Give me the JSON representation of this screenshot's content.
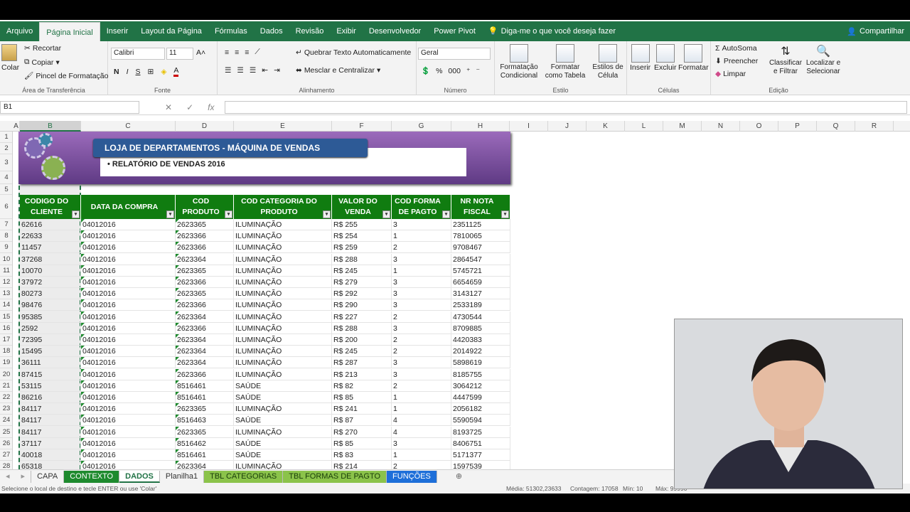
{
  "menu": {
    "items": [
      "Arquivo",
      "Página Inicial",
      "Inserir",
      "Layout da Página",
      "Fórmulas",
      "Dados",
      "Revisão",
      "Exibir",
      "Desenvolvedor",
      "Power Pivot"
    ],
    "tell_me": "Diga-me o que você deseja fazer",
    "share": "Compartilhar"
  },
  "ribbon": {
    "paste": "Colar",
    "cut": "Recortar",
    "copy": "Copiar",
    "format_painter": "Pincel de Formatação",
    "clipboard_label": "Área de Transferência",
    "font_name": "Calibri",
    "font_size": "11",
    "font_label": "Fonte",
    "wrap_text": "Quebrar Texto Automaticamente",
    "merge_center": "Mesclar e Centralizar",
    "alignment_label": "Alinhamento",
    "number_format": "Geral",
    "number_label": "Número",
    "conditional_format": "Formatação Condicional",
    "format_as_table": "Formatar como Tabela",
    "cell_styles": "Estilos de Célula",
    "style_label": "Estilo",
    "insert": "Inserir",
    "delete": "Excluir",
    "format": "Formatar",
    "cells_label": "Células",
    "autosum": "AutoSoma",
    "fill": "Preencher",
    "clear": "Limpar",
    "sort_filter": "Classificar e Filtrar",
    "find_select": "Localizar e Selecionar",
    "editing_label": "Edição"
  },
  "formula_bar": {
    "name_box": "B1",
    "formula": ""
  },
  "columns": [
    "A",
    "B",
    "C",
    "D",
    "E",
    "F",
    "G",
    "H",
    "I",
    "J",
    "K",
    "L",
    "M",
    "N",
    "O",
    "P",
    "Q",
    "R"
  ],
  "rows": [
    "1",
    "2",
    "3",
    "4",
    "5",
    "6",
    "7",
    "8",
    "9",
    "10",
    "11",
    "12",
    "13",
    "14",
    "15",
    "16",
    "17",
    "18",
    "19",
    "20",
    "21",
    "22",
    "23",
    "24",
    "25",
    "26",
    "27",
    "28"
  ],
  "banner": {
    "title": "LOJA DE DEPARTAMENTOS - MÁQUINA DE VENDAS",
    "subtitle": "• RELATÓRIO DE VENDAS 2016"
  },
  "table": {
    "headers": [
      "CODIGO DO CLIENTE",
      "DATA DA COMPRA",
      "COD PRODUTO",
      "COD CATEGORIA DO PRODUTO",
      "VALOR DO VENDA",
      "COD FORMA DE PAGTO",
      "NR NOTA FISCAL"
    ],
    "rows": [
      [
        "62616",
        "04012016",
        "2623365",
        "ILUMINAÇÃO",
        "R$ 255",
        "3",
        "2351125"
      ],
      [
        "22633",
        "04012016",
        "2623366",
        "ILUMINAÇÃO",
        "R$ 254",
        "1",
        "7810065"
      ],
      [
        "11457",
        "04012016",
        "2623366",
        "ILUMINAÇÃO",
        "R$ 259",
        "2",
        "9708467"
      ],
      [
        "37268",
        "04012016",
        "2623364",
        "ILUMINAÇÃO",
        "R$ 288",
        "3",
        "2864547"
      ],
      [
        "10070",
        "04012016",
        "2623365",
        "ILUMINAÇÃO",
        "R$ 245",
        "1",
        "5745721"
      ],
      [
        "37972",
        "04012016",
        "2623366",
        "ILUMINAÇÃO",
        "R$ 279",
        "3",
        "6654659"
      ],
      [
        "80273",
        "04012016",
        "2623365",
        "ILUMINAÇÃO",
        "R$ 292",
        "3",
        "3143127"
      ],
      [
        "98476",
        "04012016",
        "2623366",
        "ILUMINAÇÃO",
        "R$ 290",
        "3",
        "2533189"
      ],
      [
        "95385",
        "04012016",
        "2623364",
        "ILUMINAÇÃO",
        "R$ 227",
        "2",
        "4730544"
      ],
      [
        "2592",
        "04012016",
        "2623366",
        "ILUMINAÇÃO",
        "R$ 288",
        "3",
        "8709885"
      ],
      [
        "72395",
        "04012016",
        "2623364",
        "ILUMINAÇÃO",
        "R$ 200",
        "2",
        "4420383"
      ],
      [
        "15495",
        "04012016",
        "2623364",
        "ILUMINAÇÃO",
        "R$ 245",
        "2",
        "2014922"
      ],
      [
        "36111",
        "04012016",
        "2623364",
        "ILUMINAÇÃO",
        "R$ 287",
        "3",
        "5898619"
      ],
      [
        "87415",
        "04012016",
        "2623366",
        "ILUMINAÇÃO",
        "R$ 213",
        "3",
        "8185755"
      ],
      [
        "53115",
        "04012016",
        "8516461",
        "SAÚDE",
        "R$ 82",
        "2",
        "3064212"
      ],
      [
        "86216",
        "04012016",
        "8516461",
        "SAÚDE",
        "R$ 85",
        "1",
        "4447599"
      ],
      [
        "84117",
        "04012016",
        "2623365",
        "ILUMINAÇÃO",
        "R$ 241",
        "1",
        "2056182"
      ],
      [
        "84117",
        "04012016",
        "8516463",
        "SAÚDE",
        "R$ 87",
        "4",
        "5590594"
      ],
      [
        "84117",
        "04012016",
        "2623365",
        "ILUMINAÇÃO",
        "R$ 270",
        "4",
        "8193725"
      ],
      [
        "37117",
        "04012016",
        "8516462",
        "SAÚDE",
        "R$ 85",
        "3",
        "8406751"
      ],
      [
        "40018",
        "04012016",
        "8516461",
        "SAÚDE",
        "R$ 83",
        "1",
        "5171377"
      ],
      [
        "65318",
        "04012016",
        "2623364",
        "ILUMINAÇÃO",
        "R$ 214",
        "2",
        "1597539"
      ]
    ]
  },
  "sheet_tabs": [
    {
      "label": "CAPA",
      "color": ""
    },
    {
      "label": "CONTEXTO",
      "color": "#1e8a2e"
    },
    {
      "label": "DADOS",
      "color": "",
      "active": true
    },
    {
      "label": "Planilha1",
      "color": ""
    },
    {
      "label": "TBL CATEGORIAS",
      "color": "#8bc34a"
    },
    {
      "label": "TBL FORMAS DE PAGTO",
      "color": "#8bc34a"
    },
    {
      "label": "FUNÇÕES",
      "color": "#1e6fd9"
    }
  ],
  "status": {
    "message": "Selecione o local de destino e tecle ENTER ou use 'Colar'",
    "average": "Média: 51302,23633",
    "count": "Contagem: 17058",
    "min": "Mín: 10",
    "max": "Máx: 99990",
    "sum": "Soma: 875082245"
  },
  "colors": {
    "excel_green": "#217346",
    "header_green": "#107c10",
    "banner_purple": "#7b4fa0",
    "title_blue": "#2d5a96"
  }
}
